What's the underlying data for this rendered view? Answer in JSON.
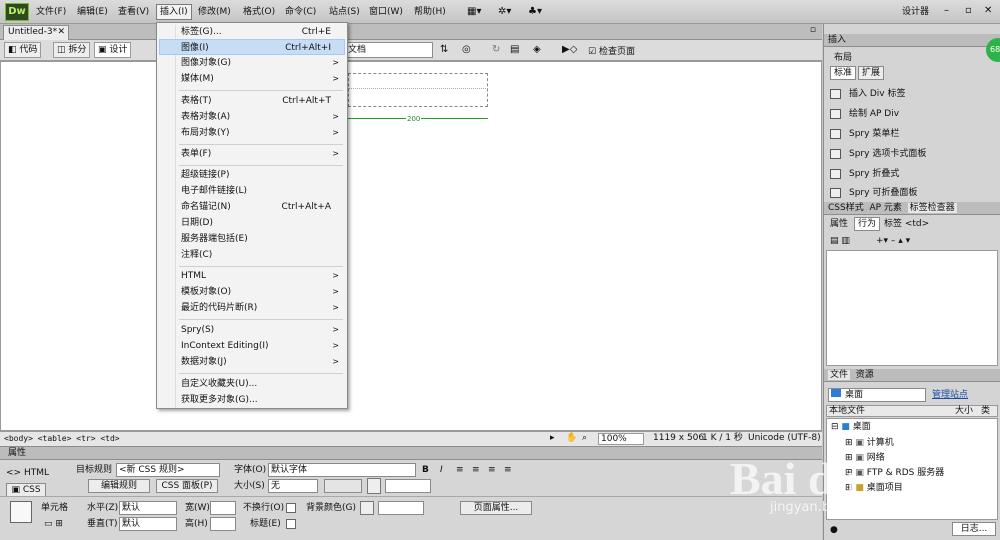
{
  "app_logo": "Dw",
  "menubar": [
    "文件(F)",
    "编辑(E)",
    "查看(V)",
    "插入(I)",
    "修改(M)",
    "格式(O)",
    "命令(C)",
    "站点(S)",
    "窗口(W)",
    "帮助(H)"
  ],
  "workspace": "设计器",
  "document_tab": "Untitled-3*",
  "doc_toolbar": {
    "code": "代码",
    "split": "拆分",
    "design": "设计",
    "title_label": "文档",
    "title_value": "文档",
    "check_page": "检查页面"
  },
  "design_view": {
    "width_indicator": "200"
  },
  "insert_menu": [
    {
      "label": "标签(G)...",
      "shortcut": "Ctrl+E",
      "arrow": false
    },
    {
      "label": "图像(I)",
      "shortcut": "Ctrl+Alt+I",
      "arrow": false,
      "highlighted": true
    },
    {
      "label": "图像对象(G)",
      "shortcut": "",
      "arrow": true
    },
    {
      "label": "媒体(M)",
      "shortcut": "",
      "arrow": true
    },
    {
      "label": "表格(T)",
      "shortcut": "Ctrl+Alt+T",
      "arrow": false
    },
    {
      "label": "表格对象(A)",
      "shortcut": "",
      "arrow": true
    },
    {
      "label": "布局对象(Y)",
      "shortcut": "",
      "arrow": true
    },
    {
      "label": "表单(F)",
      "shortcut": "",
      "arrow": true
    },
    {
      "label": "超级链接(P)",
      "shortcut": "",
      "arrow": false
    },
    {
      "label": "电子邮件链接(L)",
      "shortcut": "",
      "arrow": false
    },
    {
      "label": "命名锚记(N)",
      "shortcut": "Ctrl+Alt+A",
      "arrow": false
    },
    {
      "label": "日期(D)",
      "shortcut": "",
      "arrow": false
    },
    {
      "label": "服务器端包括(E)",
      "shortcut": "",
      "arrow": false
    },
    {
      "label": "注释(C)",
      "shortcut": "",
      "arrow": false
    },
    {
      "label": "HTML",
      "shortcut": "",
      "arrow": true
    },
    {
      "label": "模板对象(O)",
      "shortcut": "",
      "arrow": true
    },
    {
      "label": "最近的代码片断(R)",
      "shortcut": "",
      "arrow": true
    },
    {
      "label": "Spry(S)",
      "shortcut": "",
      "arrow": true
    },
    {
      "label": "InContext Editing(I)",
      "shortcut": "",
      "arrow": true
    },
    {
      "label": "数据对象(J)",
      "shortcut": "",
      "arrow": true
    },
    {
      "label": "自定义收藏夹(U)...",
      "shortcut": "",
      "arrow": false
    },
    {
      "label": "获取更多对象(G)...",
      "shortcut": "",
      "arrow": false
    }
  ],
  "tag_selector": "<body> <table> <tr> <td>",
  "status": {
    "zoom": "100%",
    "size": "1119 x 506",
    "file": "1 K / 1 秒",
    "encoding": "Unicode (UTF-8)"
  },
  "properties": {
    "title": "属性",
    "html_btn": "HTML",
    "css_btn": "CSS",
    "target_rule_label": "目标规则",
    "target_rule_value": "<新 CSS 规则>",
    "edit_rule": "编辑规则",
    "css_panel": "CSS 面板(P)",
    "font_label": "字体(O)",
    "font_value": "默认字体",
    "size_label": "大小(S)",
    "size_value": "无",
    "cell_label": "单元格",
    "horz_label": "水平(Z)",
    "horz_value": "默认",
    "vert_label": "垂直(T)",
    "vert_value": "默认",
    "width_label": "宽(W)",
    "height_label": "高(H)",
    "nowrap_label": "不换行(O)",
    "header_label": "标题(E)",
    "bgcolor_label": "背景颜色(G)",
    "page_props": "页面属性..."
  },
  "insert_panel": {
    "tab": "插入",
    "category": "布局",
    "btn_std": "标准",
    "btn_ext": "扩展",
    "items": [
      "插入 Div 标签",
      "绘制 AP Div",
      "Spry 菜单栏",
      "Spry 选项卡式面板",
      "Spry 折叠式",
      "Spry 可折叠面板"
    ]
  },
  "tag_inspector": {
    "tabs": [
      "CSS样式",
      "AP 元素",
      "标签检查器"
    ],
    "attr_tab": "属性",
    "behavior_tab": "行为",
    "tag_label": "标签 <td>"
  },
  "files_panel": {
    "tabs": [
      "文件",
      "资源"
    ],
    "site": "桌面",
    "manage": "管理站点",
    "col_local": "本地文件",
    "col_size": "大小",
    "col_type": "类",
    "tree": [
      "桌面",
      "计算机",
      "网络",
      "FTP & RDS 服务器",
      "桌面项目"
    ],
    "log_label": "日志..."
  },
  "watermark": "Bai du",
  "watermark_sub": "jingyan.baidu.com",
  "badge": "68"
}
